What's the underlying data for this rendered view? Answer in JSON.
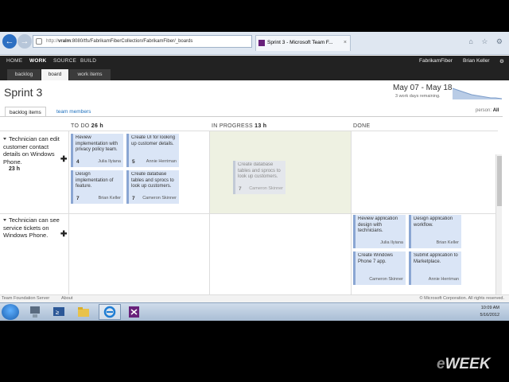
{
  "browser": {
    "address_prefix": "http://",
    "address_host": "vralm",
    "address_path": ":8080/tfs/FabrikamFiberCollection/FabrikamFiber/_boards",
    "tab_title": "Sprint 3 - Microsoft Team F...",
    "tab_close": "×",
    "back_label": "←",
    "fwd_label": "→",
    "addr_tools": "▾ ⊗ C ×"
  },
  "topnav": {
    "hubs": [
      "HOME",
      "WORK",
      "SOURCE",
      "BUILD"
    ],
    "active_hub": "WORK",
    "project": "FabrikamFiber",
    "user": "Brian Keller",
    "subtabs": [
      "backlog",
      "board",
      "work items"
    ],
    "active_subtab": "board"
  },
  "sprint": {
    "title": "Sprint 3",
    "dates": "May 07 - May 18",
    "remaining": "3 work days remaining."
  },
  "pivot": {
    "tabs": [
      "backlog items",
      "team members"
    ],
    "person_label": "person:",
    "person_value": "All"
  },
  "columns": {
    "todo_label": "TO DO",
    "todo_hours": "26 h",
    "inprog_label": "IN PROGRESS",
    "inprog_hours": "13 h",
    "done_label": "DONE"
  },
  "rows": [
    {
      "title": "Technician can edit customer contact details on Windows Phone.",
      "hours": "23 h",
      "todo": [
        {
          "title": "Review implementation with privacy policy team.",
          "hours": "4",
          "owner": "Julia Ilyiana"
        },
        {
          "title": "Create UI for looking up customer details.",
          "hours": "5",
          "owner": "Annie Herriman"
        },
        {
          "title": "Design implementation of feature.",
          "hours": "7",
          "owner": "Brian Keller"
        },
        {
          "title": "Create database tables and sprocs to look up customers.",
          "hours": "7",
          "owner": "Cameron Skinner"
        }
      ],
      "in_progress": [
        {
          "title": "Create database tables and sprocs to look up customers.",
          "hours": "7",
          "owner": "Cameron Skinner"
        }
      ]
    },
    {
      "title": "Technician can see service tickets on Windows Phone.",
      "hours": "",
      "done": [
        {
          "title": "Review application design with technicians.",
          "owner": "Julia Ilyiana"
        },
        {
          "title": "Design application workflow.",
          "owner": "Brian Keller"
        },
        {
          "title": "Create Windows Phone 7 app.",
          "owner": "Cameron Skinner"
        },
        {
          "title": "Submit application to Marketplace.",
          "owner": "Annie Herriman"
        }
      ]
    }
  ],
  "footer": {
    "product": "Team Foundation Server",
    "about": "About",
    "copyright": "© Microsoft Corporation. All rights reserved."
  },
  "taskbar": {
    "time": "10:09 AM",
    "date": "5/16/2012"
  },
  "watermark": "eWEEK",
  "colors": {
    "card": "#dae5f6",
    "card_border": "#8aa6d3",
    "inprogress_bg": "#eef1e2",
    "topbar": "#222222"
  }
}
